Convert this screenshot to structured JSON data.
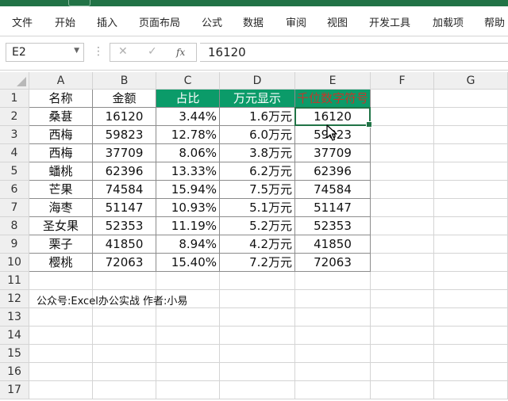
{
  "ribbon": {
    "tabs": [
      "文件",
      "开始",
      "插入",
      "页面布局",
      "公式",
      "数据",
      "审阅",
      "视图",
      "开发工具",
      "加载项",
      "帮助"
    ]
  },
  "formula_bar": {
    "name_box": "E2",
    "value": "16120",
    "fx_label": "fx"
  },
  "sheet": {
    "columns": [
      "A",
      "B",
      "C",
      "D",
      "E",
      "F",
      "G"
    ],
    "rows": [
      1,
      2,
      3,
      4,
      5,
      6,
      7,
      8,
      9,
      10,
      11,
      12,
      13,
      14,
      15,
      16,
      17
    ],
    "header_row": [
      "名称",
      "金额",
      "占比",
      "万元显示",
      "千位数字符号"
    ],
    "table": [
      [
        "桑葚",
        "16120",
        "3.44%",
        "1.6万元",
        "16120"
      ],
      [
        "西梅",
        "59823",
        "12.78%",
        "6.0万元",
        "59823"
      ],
      [
        "西梅",
        "37709",
        "8.06%",
        "3.8万元",
        "37709"
      ],
      [
        "蟠桃",
        "62396",
        "13.33%",
        "6.2万元",
        "62396"
      ],
      [
        "芒果",
        "74584",
        "15.94%",
        "7.5万元",
        "74584"
      ],
      [
        "海枣",
        "51147",
        "10.93%",
        "5.1万元",
        "51147"
      ],
      [
        "圣女果",
        "52353",
        "11.19%",
        "5.2万元",
        "52353"
      ],
      [
        "栗子",
        "41850",
        "8.94%",
        "4.2万元",
        "41850"
      ],
      [
        "樱桃",
        "72063",
        "15.40%",
        "7.2万元",
        "72063"
      ]
    ],
    "note": "公众号:Excel办公实战 作者:小易"
  },
  "colors": {
    "excel_green": "#217346",
    "header_fill": "#0b9b69",
    "header_text_red": "#c0392b"
  }
}
